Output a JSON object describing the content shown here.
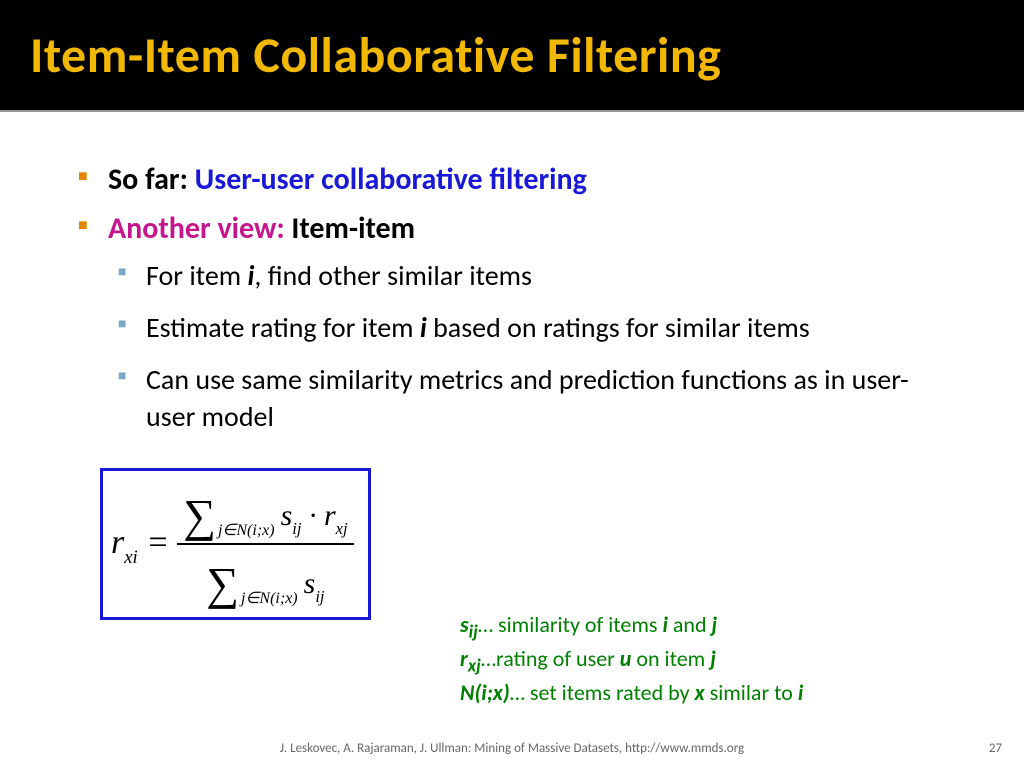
{
  "title": "Item-Item Collaborative Filtering",
  "bullets": {
    "sofar_label": "So far: ",
    "sofar_value": "User-user collaborative filtering",
    "another_label": "Another view: ",
    "another_value": "Item-item",
    "sub1_a": "For item ",
    "sub1_i": "i",
    "sub1_b": ", find other similar items",
    "sub2_a": "Estimate rating for item ",
    "sub2_i": "i",
    "sub2_b": " based on ratings for similar items",
    "sub3": "Can use same similarity metrics and prediction functions as in user-user model"
  },
  "formula": {
    "lhs_r": "r",
    "lhs_sub": "xi",
    "eq": " = ",
    "sigma": "∑",
    "sum_sub": "j∈N(i;x)",
    "s": "s",
    "s_sub": "ij",
    "dot": " · ",
    "r": "r",
    "r_sub": "xj"
  },
  "legend": {
    "l1_a": "s",
    "l1_sub": "ij",
    "l1_b": "… similarity of items ",
    "l1_i": "i",
    "l1_c": " and ",
    "l1_j": "j",
    "l2_a": "r",
    "l2_sub": "xj",
    "l2_b": "…rating of user ",
    "l2_u": "u",
    "l2_c": " on item ",
    "l2_j": "j",
    "l3_a": "N(i;x)",
    "l3_b": "… set items rated by ",
    "l3_x": "x",
    "l3_c": " similar to ",
    "l3_i": "i"
  },
  "footer": "J. Leskovec, A. Rajaraman, J. Ullman: Mining of Massive Datasets, http://www.mmds.org",
  "page": "27"
}
